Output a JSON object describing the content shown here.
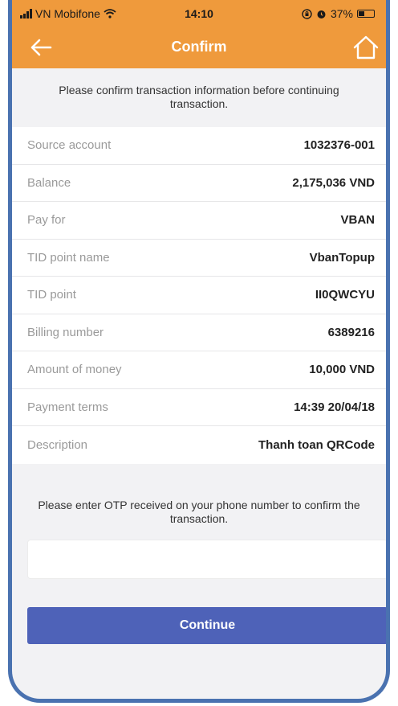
{
  "status_bar": {
    "carrier": "VN Mobifone",
    "time": "14:10",
    "battery": "37%",
    "icons": [
      "signal-icon",
      "wifi-icon",
      "screen-rotation-lock-icon",
      "alarm-icon",
      "battery-icon"
    ]
  },
  "nav": {
    "title": "Confirm",
    "back_icon": "arrow-left-icon",
    "home_icon": "home-icon"
  },
  "intro_text": "Please confirm transaction information before continuing transaction.",
  "details": [
    {
      "label": "Source account",
      "value": "1032376-001"
    },
    {
      "label": "Balance",
      "value": "2,175,036 VND"
    },
    {
      "label": "Pay for",
      "value": "VBAN"
    },
    {
      "label": "TID point name",
      "value": "VbanTopup"
    },
    {
      "label": "TID point",
      "value": "II0QWCYU"
    },
    {
      "label": "Billing number",
      "value": "6389216"
    },
    {
      "label": "Amount of money",
      "value": "10,000 VND"
    },
    {
      "label": "Payment terms",
      "value": "14:39 20/04/18"
    },
    {
      "label": "Description",
      "value": "Thanh toan QRCode"
    }
  ],
  "otp": {
    "note": "Please enter OTP received on your phone number to confirm the transaction.",
    "value": "",
    "placeholder": ""
  },
  "continue_label": "Continue",
  "colors": {
    "header": "#ef9a3c",
    "button": "#4e62b8",
    "frame": "#4a72b0",
    "background": "#f2f2f4"
  }
}
